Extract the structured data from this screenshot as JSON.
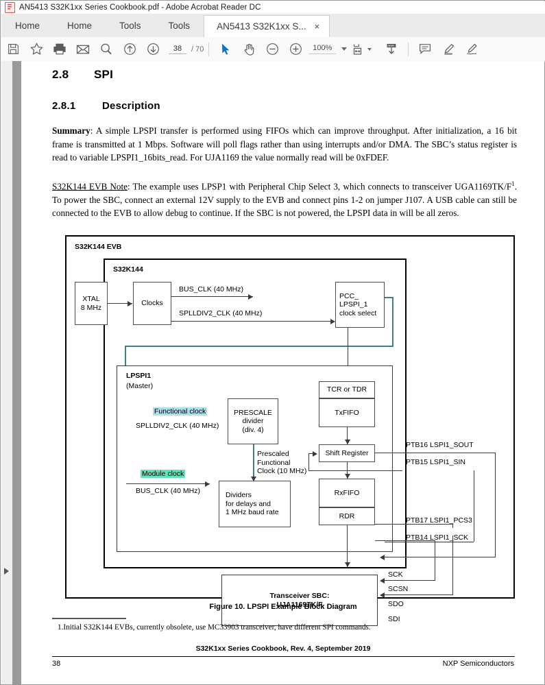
{
  "window": {
    "title": "AN5413 S32K1xx Series Cookbook.pdf - Adobe Acrobat Reader DC",
    "app_icon": "acrobat-icon"
  },
  "tabs": [
    {
      "label": "Home",
      "active": false
    },
    {
      "label": "Home",
      "active": false
    },
    {
      "label": "Tools",
      "active": false
    },
    {
      "label": "Tools",
      "active": false
    },
    {
      "label": "AN5413 S32K1xx S...",
      "active": true,
      "close": "×"
    }
  ],
  "toolbar": {
    "save_title": "Save",
    "bookmark_title": "Add Bookmark",
    "print_title": "Print",
    "email_title": "Email",
    "search_title": "Find",
    "prev_title": "Previous Page",
    "next_title": "Next Page",
    "page_current": "38",
    "page_sep": "/",
    "page_total": "70",
    "select_title": "Select Tool",
    "pan_title": "Hand Tool",
    "zoom_out_title": "Zoom Out",
    "zoom_in_title": "Zoom In",
    "zoom_value": "100%",
    "fit_title": "Fit Page",
    "scroll_title": "Scroll Mode",
    "comment_title": "Comment",
    "highlight_title": "Highlight Text",
    "sign_title": "Fill & Sign"
  },
  "document": {
    "section_number": "2.8",
    "section_title": "SPI",
    "sub_number": "2.8.1",
    "sub_title": "Description",
    "summary_label": "Summary",
    "summary_body": ": A simple LPSPI transfer is performed using FIFOs which can improve throughput. After initialization, a 16 bit frame is transmitted at 1 Mbps. Software will poll flags rather than using interrupts and/or DMA. The SBC’s status register is read to variable LPSPI1_16bits_read. For UJA1169 the value normally read will be 0xFDEF.",
    "note_label": "S32K144 EVB Note",
    "note_body_a": ": The example uses LPSP1 with Peripheral Chip Select 3, which connects to transceiver UGA1169TK/F",
    "note_superscript": "1",
    "note_body_b": ". To power the SBC, connect an external 12V supply to the EVB and connect pins 1-2 on jumper J107. A USB cable can still be connected to the EVB to allow debug to continue. If the SBC is not powered, the LPSPI data in will be all zeros.",
    "figure_caption": "Figure 10. LPSPI Example Block Diagram",
    "footnote": "1.Initial S32K144 EVBs, currently obsolete, use MC33903 transceiver, have different SPI commands.",
    "footer_center": "S32K1xx Series Cookbook, Rev. 4, September 2019",
    "footer_page": "38",
    "footer_right": "NXP Semiconductors"
  },
  "diagram": {
    "outer_label": "S32K144 EVB",
    "mcu_label": "S32K144",
    "xtal_line1": "XTAL",
    "xtal_line2": "8 MHz",
    "clocks": "Clocks",
    "bus_clk_40": "BUS_CLK (40 MHz)",
    "splldiv2_clk_40": "SPLLDIV2_CLK (40 MHz)",
    "pcc_l1": "PCC_",
    "pcc_l2": "LPSPI_1",
    "pcc_l3": "clock select",
    "lpspi1": "LPSPI1",
    "lpspi1_sub": "(Master)",
    "functional_clock": "Functional clock",
    "functional_clock_src": "SPLLDIV2_CLK (40 MHz)",
    "module_clock": "Module clock",
    "module_clock_src": "BUS_CLK (40 MHz)",
    "prescale_l1": "PRESCALE",
    "prescale_l2": "divider",
    "prescale_l3": "(div. 4)",
    "prescaled_l1": "Prescaled",
    "prescaled_l2": "Functional",
    "prescaled_l3": "Clock (10 MHz)",
    "dividers_l1": "Dividers",
    "dividers_l2": "for delays and",
    "dividers_l3": "1 MHz baud rate",
    "tcr_tdr": "TCR or TDR",
    "txfifo": "TxFIFO",
    "shift_register": "Shift Register",
    "rxfifo": "RxFIFO",
    "rdr": "RDR",
    "ptb16": "PTB16 LSPI1_SOUT",
    "ptb15": "PTB15 LSPI1_SIN",
    "ptb17": "PTB17 LSPI1_PCS3",
    "ptb14": "PTB14 LSPI1_SCK",
    "sbc_l1": "Transceiver SBC:",
    "sbc_l2": "UJA1169TK/F",
    "sck": "SCK",
    "scsn": "SCSN",
    "sdo": "SDO",
    "sdi": "SDI",
    "colors": {
      "functional_clock_highlight": "#aadff0",
      "module_clock_highlight": "#5fe3b4",
      "teal_wire": "#3f7f86",
      "line": "#3a3a3a"
    }
  }
}
